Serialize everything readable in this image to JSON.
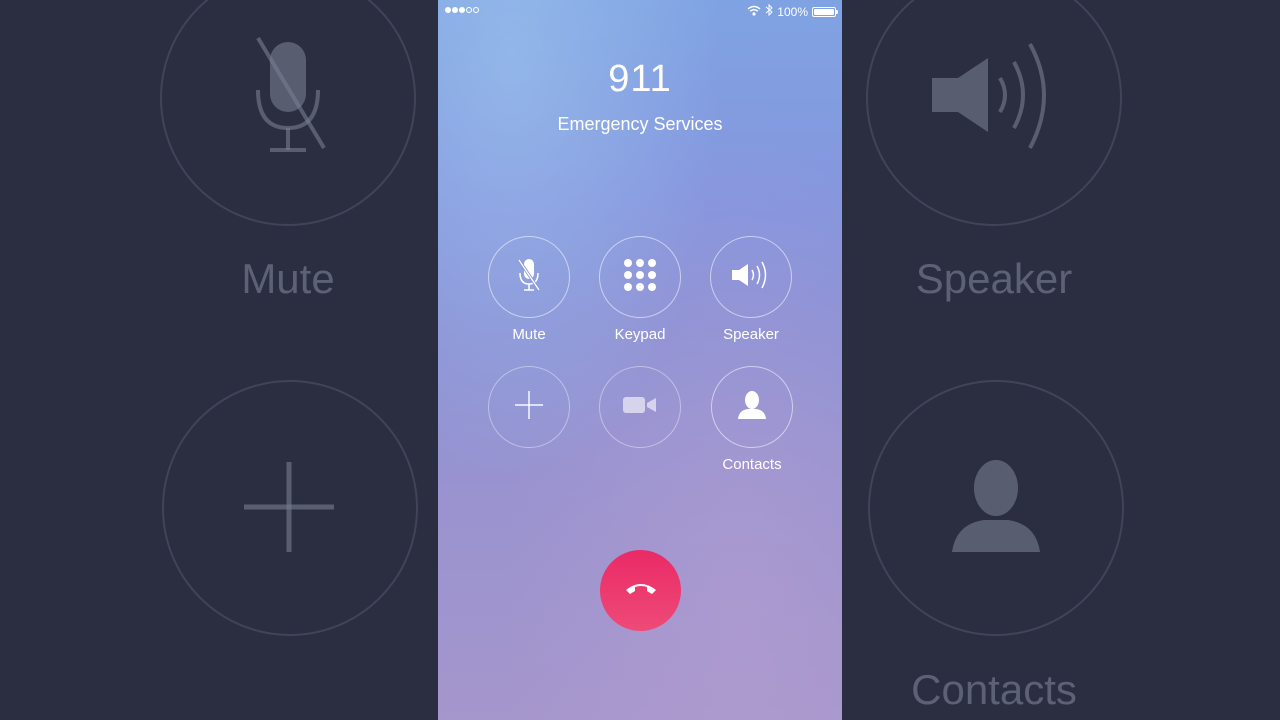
{
  "status_bar": {
    "battery": "100%",
    "battery_level": 1.0
  },
  "call": {
    "number": "911",
    "name": "Emergency Services"
  },
  "controls": [
    {
      "label": "Mute",
      "icon": "mic-muted-icon"
    },
    {
      "label": "Keypad",
      "icon": "keypad-icon"
    },
    {
      "label": "Speaker",
      "icon": "speaker-icon"
    },
    {
      "label": "",
      "icon": "plus-icon"
    },
    {
      "label": "",
      "icon": "video-camera-icon"
    },
    {
      "label": "Contacts",
      "icon": "contact-icon"
    }
  ],
  "end_call": {
    "icon": "phone-hangup-icon",
    "color": "#e92d65"
  },
  "background": {
    "left_label_top": "Mute",
    "right_label_top": "Speaker",
    "right_label_bottom": "Contacts"
  }
}
